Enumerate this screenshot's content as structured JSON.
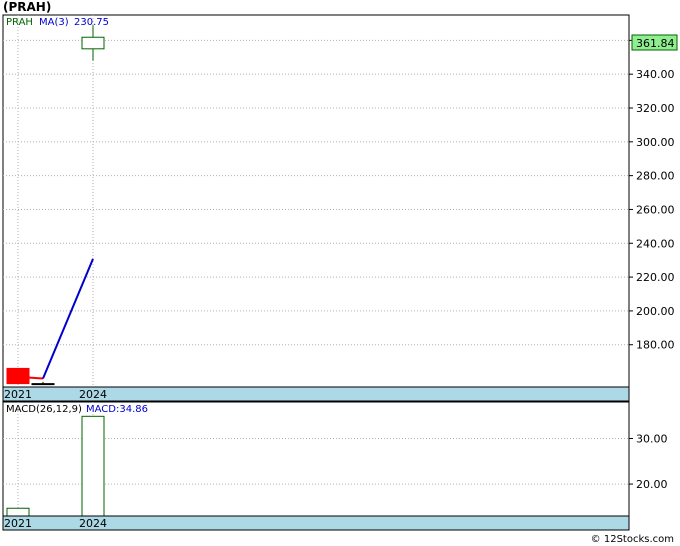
{
  "header": {
    "title": "(PRAH)"
  },
  "footer": {
    "credit": "© 12Stocks.com"
  },
  "colors": {
    "price_up": "#006400",
    "price_down": "#ff0000",
    "ma_line": "#0000cc",
    "axis_band": "#add8e6",
    "last_tag": "#90ee90"
  },
  "chart_data": [
    {
      "type": "candlestick",
      "legend": {
        "symbol": "PRAH",
        "ma_label": "MA(3)",
        "ma_value": "230.75"
      },
      "x_ticks": [
        "2021",
        "2024"
      ],
      "ylim": [
        155,
        375
      ],
      "y_ticks": [
        180,
        200,
        220,
        240,
        260,
        280,
        300,
        320,
        340,
        360
      ],
      "y_tick_labels": [
        "180.00",
        "200.00",
        "220.00",
        "240.00",
        "260.00",
        "280.00",
        "300.00",
        "320.00",
        "340.00",
        "360.00"
      ],
      "last_price_label": "361.84",
      "candles": [
        {
          "x": 2021,
          "open": 166,
          "close": 157,
          "high": 166,
          "low": 157,
          "direction": "down"
        },
        {
          "x": 2022,
          "open": 157,
          "close": 157,
          "high": 158,
          "low": 156.5,
          "direction": "flat"
        },
        {
          "x": 2024,
          "open": 355,
          "close": 361.84,
          "high": 369,
          "low": 348,
          "direction": "up"
        }
      ],
      "ma_series": [
        {
          "x": 2021,
          "y": 161,
          "color": "#ff0000"
        },
        {
          "x": 2022,
          "y": 160,
          "color": "#0000cc"
        },
        {
          "x": 2024,
          "y": 230.75,
          "color": "#0000cc"
        }
      ]
    },
    {
      "type": "bar",
      "legend": {
        "label": "MACD(26,12,9)",
        "value_label": "MACD:34.86"
      },
      "x_ticks": [
        "2021",
        "2024"
      ],
      "ylim": [
        13,
        38
      ],
      "y_ticks": [
        20,
        30
      ],
      "y_tick_labels": [
        "20.00",
        "30.00"
      ],
      "bars": [
        {
          "x": 2021,
          "value": 14.7
        },
        {
          "x": 2024,
          "value": 34.86
        }
      ]
    }
  ]
}
